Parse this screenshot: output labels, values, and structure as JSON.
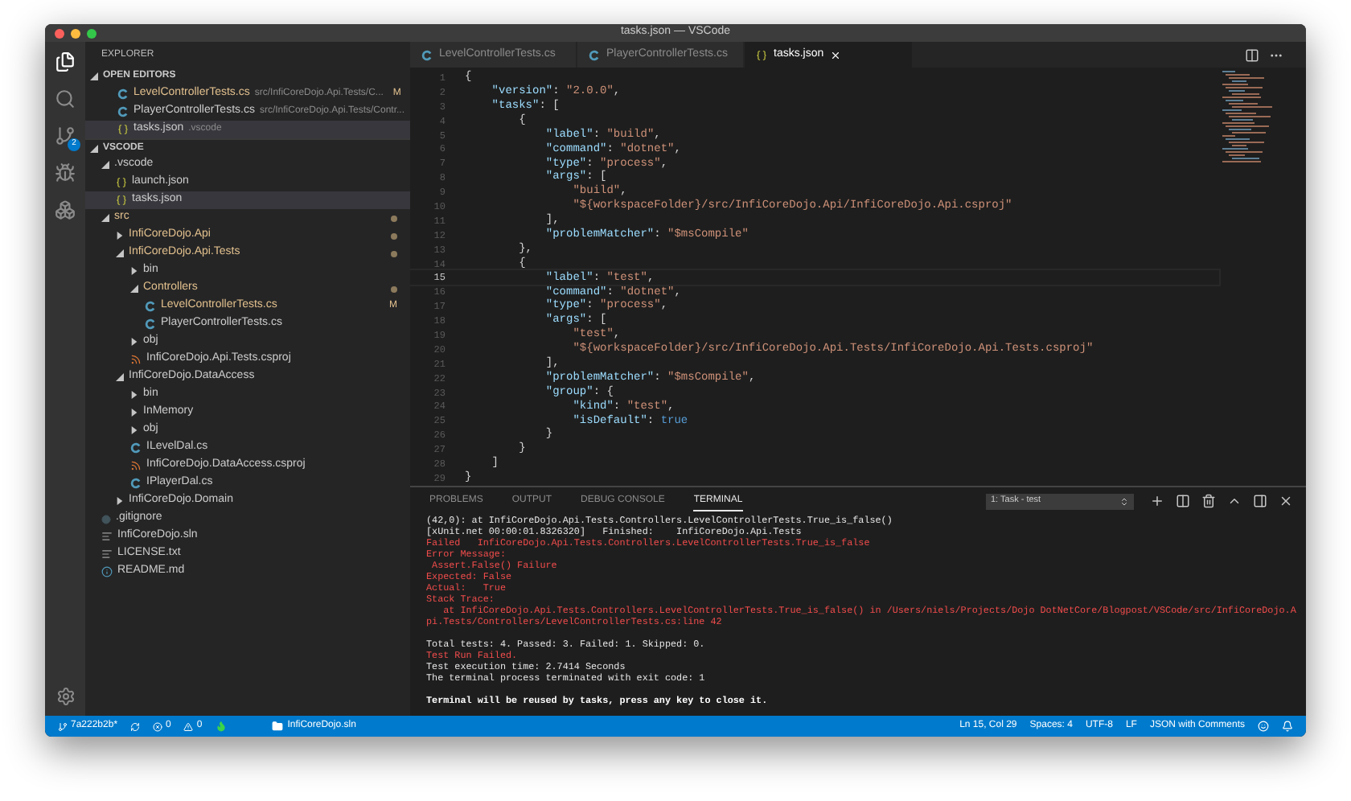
{
  "window": {
    "title": "tasks.json — VSCode"
  },
  "activity_bar": {
    "scm_badge": "2"
  },
  "sidebar": {
    "title": "EXPLORER",
    "open_editors": {
      "title": "OPEN EDITORS",
      "expanded": true,
      "items": [
        {
          "name": "LevelControllerTests.cs",
          "path": "src/InfiCoreDojo.Api.Tests/C...",
          "kind": "cs",
          "modified": true,
          "marker": "M",
          "selected": false
        },
        {
          "name": "PlayerControllerTests.cs",
          "path": "src/InfiCoreDojo.Api.Tests/Contr...",
          "kind": "cs",
          "modified": false,
          "selected": false
        },
        {
          "name": "tasks.json",
          "path": ".vscode",
          "kind": "json",
          "modified": false,
          "selected": true
        }
      ]
    },
    "folder": {
      "title": "VSCODE",
      "expanded": true,
      "items": [
        {
          "name": ".vscode",
          "kind": "folder",
          "expanded": true,
          "modified": false,
          "selected": false,
          "children": [
            {
              "name": "launch.json",
              "kind": "json",
              "modified": false,
              "selected": false
            },
            {
              "name": "tasks.json",
              "kind": "json",
              "modified": false,
              "selected": true
            }
          ]
        },
        {
          "name": "src",
          "kind": "folder",
          "expanded": true,
          "modified": true,
          "selected": false,
          "children": [
            {
              "name": "InfiCoreDojo.Api",
              "kind": "folder",
              "expanded": false,
              "modified": true,
              "selected": false
            },
            {
              "name": "InfiCoreDojo.Api.Tests",
              "kind": "folder",
              "expanded": true,
              "modified": true,
              "selected": false,
              "children": [
                {
                  "name": "bin",
                  "kind": "folder",
                  "expanded": false,
                  "modified": false,
                  "selected": false
                },
                {
                  "name": "Controllers",
                  "kind": "folder",
                  "expanded": true,
                  "modified": true,
                  "selected": false,
                  "children": [
                    {
                      "name": "LevelControllerTests.cs",
                      "kind": "cs",
                      "modified": true,
                      "marker": "M",
                      "selected": false
                    },
                    {
                      "name": "PlayerControllerTests.cs",
                      "kind": "cs",
                      "modified": false,
                      "selected": false
                    }
                  ]
                },
                {
                  "name": "obj",
                  "kind": "folder",
                  "expanded": false,
                  "modified": false,
                  "selected": false
                },
                {
                  "name": "InfiCoreDojo.Api.Tests.csproj",
                  "kind": "csproj",
                  "modified": false,
                  "selected": false
                }
              ]
            },
            {
              "name": "InfiCoreDojo.DataAccess",
              "kind": "folder",
              "expanded": true,
              "modified": false,
              "selected": false,
              "children": [
                {
                  "name": "bin",
                  "kind": "folder",
                  "expanded": false,
                  "modified": false,
                  "selected": false
                },
                {
                  "name": "InMemory",
                  "kind": "folder",
                  "expanded": false,
                  "modified": false,
                  "selected": false
                },
                {
                  "name": "obj",
                  "kind": "folder",
                  "expanded": false,
                  "modified": false,
                  "selected": false
                },
                {
                  "name": "ILevelDal.cs",
                  "kind": "cs",
                  "modified": false,
                  "selected": false
                },
                {
                  "name": "InfiCoreDojo.DataAccess.csproj",
                  "kind": "csproj",
                  "modified": false,
                  "selected": false
                },
                {
                  "name": "IPlayerDal.cs",
                  "kind": "cs",
                  "modified": false,
                  "selected": false
                }
              ]
            },
            {
              "name": "InfiCoreDojo.Domain",
              "kind": "folder",
              "expanded": false,
              "modified": false,
              "selected": false
            }
          ]
        },
        {
          "name": ".gitignore",
          "kind": "gitignore",
          "modified": false,
          "selected": false
        },
        {
          "name": "InfiCoreDojo.sln",
          "kind": "text",
          "modified": false,
          "selected": false
        },
        {
          "name": "LICENSE.txt",
          "kind": "text",
          "modified": false,
          "selected": false
        },
        {
          "name": "README.md",
          "kind": "info",
          "modified": false,
          "selected": false
        }
      ]
    }
  },
  "editor": {
    "tabs": [
      {
        "label": "LevelControllerTests.cs",
        "kind": "cs",
        "selected": false
      },
      {
        "label": "PlayerControllerTests.cs",
        "kind": "cs",
        "selected": false
      },
      {
        "label": "tasks.json",
        "kind": "json",
        "selected": true
      }
    ],
    "lines": [
      {
        "number": "1",
        "current": false,
        "tokens": [
          {
            "kind": "punct",
            "text": "{"
          }
        ]
      },
      {
        "number": "2",
        "current": false,
        "tokens": [
          {
            "kind": "key",
            "text": "    \"version\""
          },
          {
            "kind": "punct",
            "text": ": "
          },
          {
            "kind": "string",
            "text": "\"2.0.0\""
          },
          {
            "kind": "punct",
            "text": ","
          }
        ]
      },
      {
        "number": "3",
        "current": false,
        "tokens": [
          {
            "kind": "key",
            "text": "    \"tasks\""
          },
          {
            "kind": "punct",
            "text": ": ["
          }
        ]
      },
      {
        "number": "4",
        "current": false,
        "tokens": [
          {
            "kind": "punct",
            "text": "        {"
          }
        ]
      },
      {
        "number": "5",
        "current": false,
        "tokens": [
          {
            "kind": "key",
            "text": "            \"label\""
          },
          {
            "kind": "punct",
            "text": ": "
          },
          {
            "kind": "string",
            "text": "\"build\""
          },
          {
            "kind": "punct",
            "text": ","
          }
        ]
      },
      {
        "number": "6",
        "current": false,
        "tokens": [
          {
            "kind": "key",
            "text": "            \"command\""
          },
          {
            "kind": "punct",
            "text": ": "
          },
          {
            "kind": "string",
            "text": "\"dotnet\""
          },
          {
            "kind": "punct",
            "text": ","
          }
        ]
      },
      {
        "number": "7",
        "current": false,
        "tokens": [
          {
            "kind": "key",
            "text": "            \"type\""
          },
          {
            "kind": "punct",
            "text": ": "
          },
          {
            "kind": "string",
            "text": "\"process\""
          },
          {
            "kind": "punct",
            "text": ","
          }
        ]
      },
      {
        "number": "8",
        "current": false,
        "tokens": [
          {
            "kind": "key",
            "text": "            \"args\""
          },
          {
            "kind": "punct",
            "text": ": ["
          }
        ]
      },
      {
        "number": "9",
        "current": false,
        "tokens": [
          {
            "kind": "string",
            "text": "                \"build\""
          },
          {
            "kind": "punct",
            "text": ","
          }
        ]
      },
      {
        "number": "10",
        "current": false,
        "tokens": [
          {
            "kind": "string",
            "text": "                \"${workspaceFolder}/src/InfiCoreDojo.Api/InfiCoreDojo.Api.csproj\""
          }
        ]
      },
      {
        "number": "11",
        "current": false,
        "tokens": [
          {
            "kind": "punct",
            "text": "            ],"
          }
        ]
      },
      {
        "number": "12",
        "current": false,
        "tokens": [
          {
            "kind": "key",
            "text": "            \"problemMatcher\""
          },
          {
            "kind": "punct",
            "text": ": "
          },
          {
            "kind": "string",
            "text": "\"$msCompile\""
          }
        ]
      },
      {
        "number": "13",
        "current": false,
        "tokens": [
          {
            "kind": "punct",
            "text": "        },"
          }
        ]
      },
      {
        "number": "14",
        "current": false,
        "tokens": [
          {
            "kind": "punct",
            "text": "        {"
          }
        ]
      },
      {
        "number": "15",
        "current": true,
        "tokens": [
          {
            "kind": "key",
            "text": "            \"label\""
          },
          {
            "kind": "punct",
            "text": ": "
          },
          {
            "kind": "string",
            "text": "\"test\""
          },
          {
            "kind": "punct",
            "text": ","
          }
        ]
      },
      {
        "number": "16",
        "current": false,
        "tokens": [
          {
            "kind": "key",
            "text": "            \"command\""
          },
          {
            "kind": "punct",
            "text": ": "
          },
          {
            "kind": "string",
            "text": "\"dotnet\""
          },
          {
            "kind": "punct",
            "text": ","
          }
        ]
      },
      {
        "number": "17",
        "current": false,
        "tokens": [
          {
            "kind": "key",
            "text": "            \"type\""
          },
          {
            "kind": "punct",
            "text": ": "
          },
          {
            "kind": "string",
            "text": "\"process\""
          },
          {
            "kind": "punct",
            "text": ","
          }
        ]
      },
      {
        "number": "18",
        "current": false,
        "tokens": [
          {
            "kind": "key",
            "text": "            \"args\""
          },
          {
            "kind": "punct",
            "text": ": ["
          }
        ]
      },
      {
        "number": "19",
        "current": false,
        "tokens": [
          {
            "kind": "string",
            "text": "                \"test\""
          },
          {
            "kind": "punct",
            "text": ","
          }
        ]
      },
      {
        "number": "20",
        "current": false,
        "tokens": [
          {
            "kind": "string",
            "text": "                \"${workspaceFolder}/src/InfiCoreDojo.Api.Tests/InfiCoreDojo.Api.Tests.csproj\""
          }
        ]
      },
      {
        "number": "21",
        "current": false,
        "tokens": [
          {
            "kind": "punct",
            "text": "            ],"
          }
        ]
      },
      {
        "number": "22",
        "current": false,
        "tokens": [
          {
            "kind": "key",
            "text": "            \"problemMatcher\""
          },
          {
            "kind": "punct",
            "text": ": "
          },
          {
            "kind": "string",
            "text": "\"$msCompile\""
          },
          {
            "kind": "punct",
            "text": ","
          }
        ]
      },
      {
        "number": "23",
        "current": false,
        "tokens": [
          {
            "kind": "key",
            "text": "            \"group\""
          },
          {
            "kind": "punct",
            "text": ": {"
          }
        ]
      },
      {
        "number": "24",
        "current": false,
        "tokens": [
          {
            "kind": "key",
            "text": "                \"kind\""
          },
          {
            "kind": "punct",
            "text": ": "
          },
          {
            "kind": "string",
            "text": "\"test\""
          },
          {
            "kind": "punct",
            "text": ","
          }
        ]
      },
      {
        "number": "25",
        "current": false,
        "tokens": [
          {
            "kind": "key",
            "text": "                \"isDefault\""
          },
          {
            "kind": "punct",
            "text": ": "
          },
          {
            "kind": "bool",
            "text": "true"
          }
        ]
      },
      {
        "number": "26",
        "current": false,
        "tokens": [
          {
            "kind": "punct",
            "text": "            }"
          }
        ]
      },
      {
        "number": "27",
        "current": false,
        "tokens": [
          {
            "kind": "punct",
            "text": "        }"
          }
        ]
      },
      {
        "number": "28",
        "current": false,
        "tokens": [
          {
            "kind": "punct",
            "text": "    ]"
          }
        ]
      },
      {
        "number": "29",
        "current": false,
        "tokens": [
          {
            "kind": "punct",
            "text": "}"
          }
        ]
      }
    ]
  },
  "panel": {
    "tabs": [
      {
        "label": "PROBLEMS",
        "selected": false
      },
      {
        "label": "OUTPUT",
        "selected": false
      },
      {
        "label": "DEBUG CONSOLE",
        "selected": false
      },
      {
        "label": "TERMINAL",
        "selected": true
      }
    ],
    "terminal_select": "1: Task - test",
    "blocks": [
      [
        {
          "text": "(42,0): at InfiCoreDojo.Api.Tests.Controllers.LevelControllerTests.True_is_false()",
          "kind": "normal"
        },
        {
          "text": "[xUnit.net 00:00:01.8326320]   Finished:    InfiCoreDojo.Api.Tests",
          "kind": "normal"
        },
        {
          "text": "Failed   InfiCoreDojo.Api.Tests.Controllers.LevelControllerTests.True_is_false",
          "kind": "error"
        },
        {
          "text": "Error Message:",
          "kind": "error"
        },
        {
          "text": " Assert.False() Failure",
          "kind": "error"
        },
        {
          "text": "Expected: False",
          "kind": "error"
        },
        {
          "text": "Actual:   True",
          "kind": "error"
        },
        {
          "text": "Stack Trace:",
          "kind": "error"
        },
        {
          "text": "   at InfiCoreDojo.Api.Tests.Controllers.LevelControllerTests.True_is_false() in /Users/niels/Projects/Dojo DotNetCore/Blogpost/VSCode/src/InfiCoreDojo.A",
          "kind": "error"
        },
        {
          "text": "pi.Tests/Controllers/LevelControllerTests.cs:line 42",
          "kind": "error"
        }
      ],
      [
        {
          "text": "Total tests: 4. Passed: 3. Failed: 1. Skipped: 0.",
          "kind": "normal"
        },
        {
          "text": "Test Run Failed.",
          "kind": "error"
        },
        {
          "text": "Test execution time: 2.7414 Seconds",
          "kind": "normal"
        },
        {
          "text": "The terminal process terminated with exit code: 1",
          "kind": "normal"
        }
      ],
      [
        {
          "text": "Terminal will be reused by tasks, press any key to close it.",
          "kind": "notice"
        }
      ]
    ]
  },
  "status_bar": {
    "branch": "7a222b2b*",
    "errors": "0",
    "warnings": "0",
    "solution": "InfiCoreDojo.sln",
    "right": [
      "Ln 15, Col 29",
      "Spaces: 4",
      "UTF-8",
      "LF",
      "JSON with Comments"
    ]
  }
}
